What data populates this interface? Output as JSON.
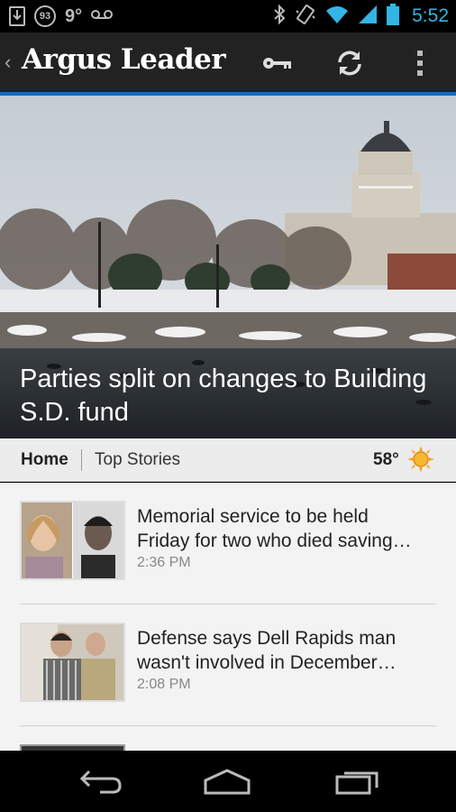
{
  "status_bar": {
    "badge_value": "93",
    "temperature": "9°",
    "voicemail_icon": "voicemail-icon",
    "clock": "5:52",
    "icons": [
      "download-icon",
      "bluetooth-icon",
      "vibrate-icon",
      "wifi-icon",
      "signal-icon",
      "battery-icon"
    ]
  },
  "action_bar": {
    "app_title": "Argus Leader",
    "icons": [
      "back-chevron-icon",
      "key-icon",
      "refresh-icon",
      "overflow-menu-icon"
    ]
  },
  "hero": {
    "headline": "Parties split on changes to Building S.D. fund"
  },
  "tabs": {
    "home": "Home",
    "top_stories": "Top Stories",
    "weather_temp": "58°",
    "weather_icon": "sun-icon"
  },
  "articles": [
    {
      "line1": "Memorial service to be held",
      "line2": "Friday for two who died saving…",
      "time": "2:36 PM"
    },
    {
      "line1": "Defense says Dell Rapids man",
      "line2": "wasn't involved in December…",
      "time": "2:08 PM"
    }
  ],
  "nav_bar": {
    "icons": [
      "back-icon",
      "home-icon",
      "recent-apps-icon"
    ]
  },
  "colors": {
    "accent_blue": "#33b5e5",
    "action_bar_line": "#1e67b6",
    "action_bar_bg": "#222222"
  }
}
